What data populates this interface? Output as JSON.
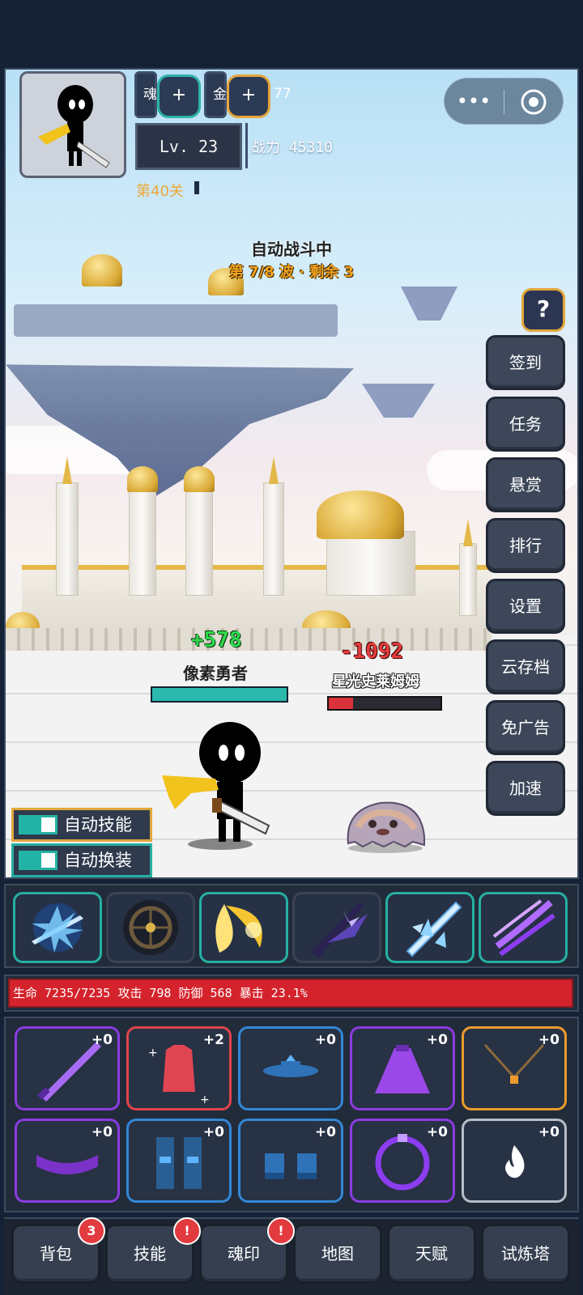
{
  "resources": [
    {
      "label": "魂",
      "value": ""
    },
    {
      "label": "金",
      "value": "77"
    }
  ],
  "player": {
    "level": "Lv. 23",
    "power": "战力 45310",
    "stage": "第40关"
  },
  "battle": {
    "status": "自动战斗中",
    "wave": "第 7/8 波 · 剩余 3",
    "hero": {
      "name": "像素勇者",
      "heal": "+578",
      "hp_percent": 100
    },
    "enemy": {
      "name": "星光史莱姆姆",
      "damage": "-1092",
      "hp_percent": 22
    }
  },
  "capsule": {
    "more_icon": "more-dots-icon",
    "close_icon": "target-circle-icon"
  },
  "side_menu": {
    "help": "?",
    "items": [
      "签到",
      "任务",
      "悬赏",
      "排行",
      "设置",
      "云存档",
      "免广告",
      "加速"
    ]
  },
  "toggles": [
    {
      "label": "自动技能",
      "on": true
    },
    {
      "label": "自动换装",
      "on": true
    }
  ],
  "skills": [
    "lightning-sword-icon",
    "dark-wheel-icon",
    "golden-crescent-icon",
    "shadow-blade-icon",
    "ice-sword-icon",
    "purple-slash-icon"
  ],
  "stats": "生命 7235/7235 攻击 798 防御 568 暴击 23.1%",
  "equipment": [
    {
      "icon": "sword-icon",
      "level": "+0",
      "rarity": "purple"
    },
    {
      "icon": "armor-icon",
      "level": "+2",
      "rarity": "red"
    },
    {
      "icon": "hat-icon",
      "level": "+0",
      "rarity": "blue"
    },
    {
      "icon": "cloak-icon",
      "level": "+0",
      "rarity": "purple"
    },
    {
      "icon": "necklace-icon",
      "level": "+0",
      "rarity": "orange"
    },
    {
      "icon": "belt-icon",
      "level": "+0",
      "rarity": "purple"
    },
    {
      "icon": "greaves-icon",
      "level": "+0",
      "rarity": "blue"
    },
    {
      "icon": "gloves-icon",
      "level": "+0",
      "rarity": "blue"
    },
    {
      "icon": "ring-icon",
      "level": "+0",
      "rarity": "purple"
    },
    {
      "icon": "flame-icon",
      "level": "+0",
      "rarity": "white"
    }
  ],
  "bottom_nav": [
    {
      "label": "背包",
      "badge": "3"
    },
    {
      "label": "技能",
      "badge": "!"
    },
    {
      "label": "魂印",
      "badge": "!"
    },
    {
      "label": "地图",
      "badge": ""
    },
    {
      "label": "天赋",
      "badge": ""
    },
    {
      "label": "试炼塔",
      "badge": ""
    }
  ],
  "colors": {
    "accent_teal": "#26b0a2",
    "accent_gold": "#e2a73a",
    "hp_red": "#d4232c",
    "heal_green": "#2fd94e"
  }
}
